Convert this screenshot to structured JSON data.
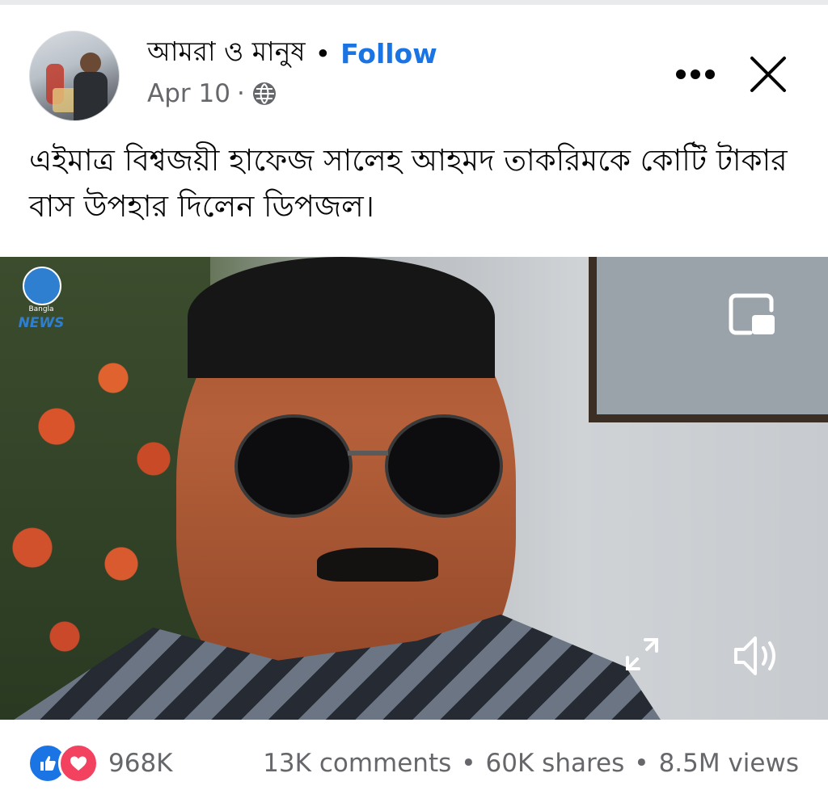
{
  "post": {
    "author": "আমরা ও মানুষ",
    "separator": "•",
    "follow_label": "Follow",
    "date": "Apr 10",
    "meta_separator": "·",
    "privacy_icon": "globe-icon",
    "caption": "এইমাত্র বিশ্বজয়ী হাফেজ সালেহ আহমদ তাকরিমকে কোটি টাকার বাস উপহার দিলেন ডিপজল।"
  },
  "header_actions": {
    "more_icon": "more-horizontal-icon",
    "close_icon": "close-icon"
  },
  "media": {
    "watermark_small": "Bangla",
    "watermark": "NEWS",
    "pip_icon": "picture-in-picture-icon",
    "expand_icon": "expand-icon",
    "volume_icon": "volume-icon"
  },
  "footer": {
    "reactions": [
      "like-icon",
      "love-icon"
    ],
    "reaction_count": "968K",
    "comments": "13K comments",
    "shares": "60K shares",
    "views": "8.5M views",
    "separator": "•"
  },
  "colors": {
    "accent": "#1b74e4",
    "love": "#f3425f",
    "secondary_text": "#65676b"
  }
}
